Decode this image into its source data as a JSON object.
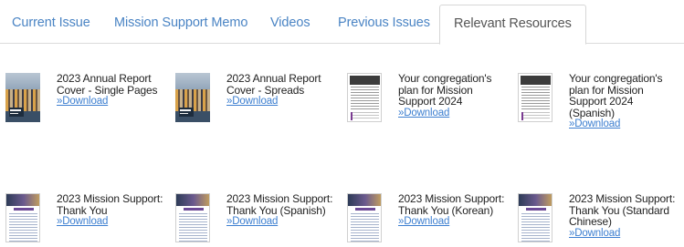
{
  "tabs": [
    {
      "label": "Current Issue",
      "active": false
    },
    {
      "label": "Mission Support Memo",
      "active": false
    },
    {
      "label": "Videos",
      "active": false
    },
    {
      "label": "Previous Issues",
      "active": false
    },
    {
      "label": "Relevant Resources",
      "active": true
    }
  ],
  "resources": [
    {
      "title_lines": [
        "2023 Annual Report",
        "Cover - Single Pages"
      ],
      "link": "»Download",
      "thumb": "report-cover-image"
    },
    {
      "title_lines": [
        "2023 Annual Report",
        "Cover - Spreads"
      ],
      "link": "»Download",
      "thumb": "report-cover-image"
    },
    {
      "title_lines": [
        "Your congregation's",
        "plan for Mission",
        "Support 2024"
      ],
      "link": "»Download",
      "thumb": "document-page-image"
    },
    {
      "title_lines": [
        "Your congregation's",
        "plan for Mission",
        "Support 2024",
        "(Spanish)"
      ],
      "link": "»Download",
      "thumb": "document-page-image"
    },
    {
      "title_lines": [
        "2023 Mission Support:",
        "Thank You"
      ],
      "link": "»Download",
      "thumb": "thank-you-page-image"
    },
    {
      "title_lines": [
        "2023 Mission Support:",
        "Thank You (Spanish)"
      ],
      "link": "»Download",
      "thumb": "thank-you-page-image"
    },
    {
      "title_lines": [
        "2023 Mission Support:",
        "Thank You (Korean)"
      ],
      "link": "»Download",
      "thumb": "thank-you-page-image"
    },
    {
      "title_lines": [
        "2023 Mission Support:",
        "Thank You (Standard",
        "Chinese)"
      ],
      "link": "»Download",
      "thumb": "thank-you-page-image"
    }
  ],
  "colors": {
    "tab_link": "#4a84c4",
    "download_link": "#3d7fd0",
    "active_tab_text": "#555555"
  }
}
